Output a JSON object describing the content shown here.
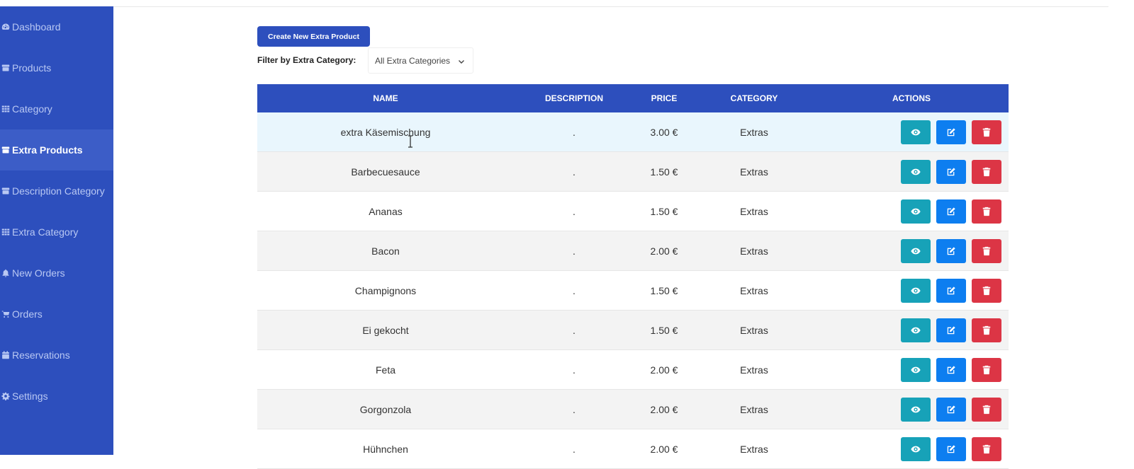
{
  "sidebar": {
    "items": [
      {
        "label": "Dashboard",
        "icon": "dashboard-icon",
        "active": false
      },
      {
        "label": "Products",
        "icon": "box-icon",
        "active": false
      },
      {
        "label": "Category",
        "icon": "grid-icon",
        "active": false
      },
      {
        "label": "Extra Products",
        "icon": "box-icon",
        "active": true
      },
      {
        "label": "Description Category",
        "icon": "box-icon",
        "active": false
      },
      {
        "label": "Extra Category",
        "icon": "grid-icon",
        "active": false
      },
      {
        "label": "New Orders",
        "icon": "bell-icon",
        "active": false
      },
      {
        "label": "Orders",
        "icon": "cart-icon",
        "active": false
      },
      {
        "label": "Reservations",
        "icon": "calendar-icon",
        "active": false
      },
      {
        "label": "Settings",
        "icon": "gear-icon",
        "active": false
      }
    ]
  },
  "toolbar": {
    "create_label": "Create New Extra Product",
    "filter_label": "Filter by Extra Category:",
    "filter_value": "All Extra Categories"
  },
  "table": {
    "headers": {
      "name": "NAME",
      "description": "DESCRIPTION",
      "price": "PRICE",
      "category": "CATEGORY",
      "actions": "ACTIONS"
    },
    "rows": [
      {
        "name": "extra Käsemischung",
        "description": ".",
        "price": "3.00 €",
        "category": "Extras"
      },
      {
        "name": "Barbecuesauce",
        "description": ".",
        "price": "1.50 €",
        "category": "Extras"
      },
      {
        "name": "Ananas",
        "description": ".",
        "price": "1.50 €",
        "category": "Extras"
      },
      {
        "name": "Bacon",
        "description": ".",
        "price": "2.00 €",
        "category": "Extras"
      },
      {
        "name": "Champignons",
        "description": ".",
        "price": "1.50 €",
        "category": "Extras"
      },
      {
        "name": "Ei gekocht",
        "description": ".",
        "price": "1.50 €",
        "category": "Extras"
      },
      {
        "name": "Feta",
        "description": ".",
        "price": "2.00 €",
        "category": "Extras"
      },
      {
        "name": "Gorgonzola",
        "description": ".",
        "price": "2.00 €",
        "category": "Extras"
      },
      {
        "name": "Hühnchen",
        "description": ".",
        "price": "2.00 €",
        "category": "Extras"
      }
    ]
  },
  "colors": {
    "sidebar_bg": "#2d4fbd",
    "header_bg": "#2d4fbd",
    "view_btn": "#17a2b8",
    "edit_btn": "#0d7ef0",
    "delete_btn": "#dc3545"
  }
}
